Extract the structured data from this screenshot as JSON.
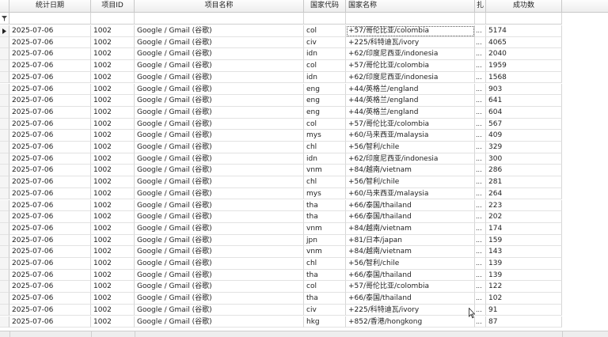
{
  "columns": {
    "date": "统计日期",
    "project_id": "项目ID",
    "project_name": "项目名称",
    "country_code": "国家代码",
    "country_name": "国家名称",
    "truncated": "扎",
    "success_count": "成功数"
  },
  "filter_icon": "funnel-icon",
  "current_row_icon": "row-pointer-icon",
  "rows": [
    {
      "date": "2025-07-06",
      "id": "1002",
      "name": "Google / Gmail (谷歌)",
      "code": "col",
      "country": "+57/哥伦比亚/colombia",
      "more": "...",
      "count": "5174"
    },
    {
      "date": "2025-07-06",
      "id": "1002",
      "name": "Google / Gmail (谷歌)",
      "code": "civ",
      "country": "+225/科特迪瓦/ivory",
      "more": "...",
      "count": "4065"
    },
    {
      "date": "2025-07-06",
      "id": "1002",
      "name": "Google / Gmail (谷歌)",
      "code": "idn",
      "country": "+62/印度尼西亚/indonesia",
      "more": "...",
      "count": "2040"
    },
    {
      "date": "2025-07-06",
      "id": "1002",
      "name": "Google / Gmail (谷歌)",
      "code": "col",
      "country": "+57/哥伦比亚/colombia",
      "more": "...",
      "count": "1959"
    },
    {
      "date": "2025-07-06",
      "id": "1002",
      "name": "Google / Gmail (谷歌)",
      "code": "idn",
      "country": "+62/印度尼西亚/indonesia",
      "more": "...",
      "count": "1568"
    },
    {
      "date": "2025-07-06",
      "id": "1002",
      "name": "Google / Gmail (谷歌)",
      "code": "eng",
      "country": "+44/英格兰/england",
      "more": "...",
      "count": "903"
    },
    {
      "date": "2025-07-06",
      "id": "1002",
      "name": "Google / Gmail (谷歌)",
      "code": "eng",
      "country": "+44/英格兰/england",
      "more": "...",
      "count": "641"
    },
    {
      "date": "2025-07-06",
      "id": "1002",
      "name": "Google / Gmail (谷歌)",
      "code": "eng",
      "country": "+44/英格兰/england",
      "more": "...",
      "count": "604"
    },
    {
      "date": "2025-07-06",
      "id": "1002",
      "name": "Google / Gmail (谷歌)",
      "code": "col",
      "country": "+57/哥伦比亚/colombia",
      "more": "...",
      "count": "567"
    },
    {
      "date": "2025-07-06",
      "id": "1002",
      "name": "Google / Gmail (谷歌)",
      "code": "mys",
      "country": "+60/马来西亚/malaysia",
      "more": "...",
      "count": "409"
    },
    {
      "date": "2025-07-06",
      "id": "1002",
      "name": "Google / Gmail (谷歌)",
      "code": "chl",
      "country": "+56/智利/chile",
      "more": "...",
      "count": "329"
    },
    {
      "date": "2025-07-06",
      "id": "1002",
      "name": "Google / Gmail (谷歌)",
      "code": "idn",
      "country": "+62/印度尼西亚/indonesia",
      "more": "...",
      "count": "300"
    },
    {
      "date": "2025-07-06",
      "id": "1002",
      "name": "Google / Gmail (谷歌)",
      "code": "vnm",
      "country": "+84/越南/vietnam",
      "more": "...",
      "count": "286"
    },
    {
      "date": "2025-07-06",
      "id": "1002",
      "name": "Google / Gmail (谷歌)",
      "code": "chl",
      "country": "+56/智利/chile",
      "more": "...",
      "count": "281"
    },
    {
      "date": "2025-07-06",
      "id": "1002",
      "name": "Google / Gmail (谷歌)",
      "code": "mys",
      "country": "+60/马来西亚/malaysia",
      "more": "...",
      "count": "264"
    },
    {
      "date": "2025-07-06",
      "id": "1002",
      "name": "Google / Gmail (谷歌)",
      "code": "tha",
      "country": "+66/泰国/thailand",
      "more": "...",
      "count": "223"
    },
    {
      "date": "2025-07-06",
      "id": "1002",
      "name": "Google / Gmail (谷歌)",
      "code": "tha",
      "country": "+66/泰国/thailand",
      "more": "...",
      "count": "202"
    },
    {
      "date": "2025-07-06",
      "id": "1002",
      "name": "Google / Gmail (谷歌)",
      "code": "vnm",
      "country": "+84/越南/vietnam",
      "more": "...",
      "count": "174"
    },
    {
      "date": "2025-07-06",
      "id": "1002",
      "name": "Google / Gmail (谷歌)",
      "code": "jpn",
      "country": "+81/日本/japan",
      "more": "...",
      "count": "159"
    },
    {
      "date": "2025-07-06",
      "id": "1002",
      "name": "Google / Gmail (谷歌)",
      "code": "vnm",
      "country": "+84/越南/vietnam",
      "more": "...",
      "count": "143"
    },
    {
      "date": "2025-07-06",
      "id": "1002",
      "name": "Google / Gmail (谷歌)",
      "code": "chl",
      "country": "+56/智利/chile",
      "more": "...",
      "count": "139"
    },
    {
      "date": "2025-07-06",
      "id": "1002",
      "name": "Google / Gmail (谷歌)",
      "code": "tha",
      "country": "+66/泰国/thailand",
      "more": "...",
      "count": "139"
    },
    {
      "date": "2025-07-06",
      "id": "1002",
      "name": "Google / Gmail (谷歌)",
      "code": "col",
      "country": "+57/哥伦比亚/colombia",
      "more": "...",
      "count": "122"
    },
    {
      "date": "2025-07-06",
      "id": "1002",
      "name": "Google / Gmail (谷歌)",
      "code": "tha",
      "country": "+66/泰国/thailand",
      "more": "...",
      "count": "102"
    },
    {
      "date": "2025-07-06",
      "id": "1002",
      "name": "Google / Gmail (谷歌)",
      "code": "civ",
      "country": "+225/科特迪瓦/ivory",
      "more": "...",
      "count": "91"
    },
    {
      "date": "2025-07-06",
      "id": "1002",
      "name": "Google / Gmail (谷歌)",
      "code": "hkg",
      "country": "+852/香港/hongkong",
      "more": "...",
      "count": "87"
    }
  ]
}
